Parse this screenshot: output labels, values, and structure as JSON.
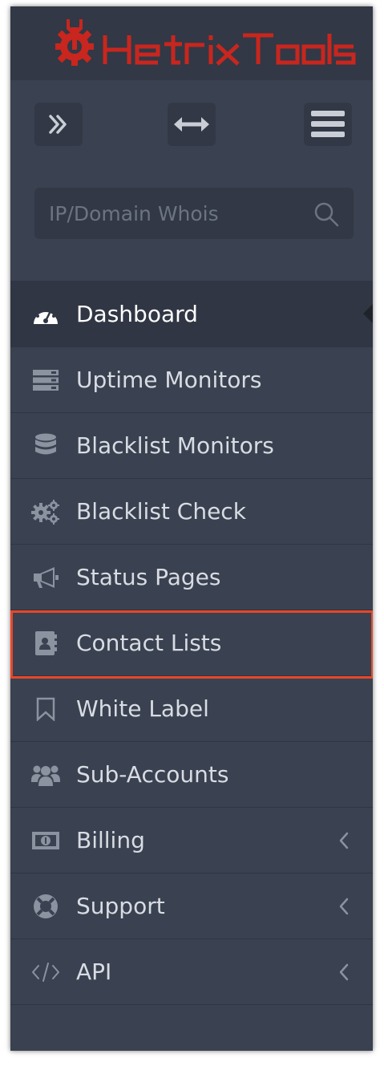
{
  "brand": {
    "name": "HetrixTools",
    "color": "#c8261e"
  },
  "toolbar": {
    "expand_icon": "double-chevron-right-icon",
    "resize_icon": "horizontal-arrows-icon",
    "menu_icon": "hamburger-icon"
  },
  "search": {
    "placeholder": "IP/Domain Whois",
    "value": "",
    "icon": "search-icon"
  },
  "menu": {
    "items": [
      {
        "label": "Dashboard",
        "icon": "gauge-icon",
        "active": true,
        "has_submenu": false
      },
      {
        "label": "Uptime Monitors",
        "icon": "server-icon",
        "active": false,
        "has_submenu": false
      },
      {
        "label": "Blacklist Monitors",
        "icon": "database-icon",
        "active": false,
        "has_submenu": false
      },
      {
        "label": "Blacklist Check",
        "icon": "gears-icon",
        "active": false,
        "has_submenu": false
      },
      {
        "label": "Status Pages",
        "icon": "megaphone-icon",
        "active": false,
        "has_submenu": false
      },
      {
        "label": "Contact Lists",
        "icon": "address-book-icon",
        "active": false,
        "highlighted": true,
        "has_submenu": false
      },
      {
        "label": "White Label",
        "icon": "bookmark-icon",
        "active": false,
        "has_submenu": false
      },
      {
        "label": "Sub-Accounts",
        "icon": "users-icon",
        "active": false,
        "has_submenu": false
      },
      {
        "label": "Billing",
        "icon": "money-bill-icon",
        "active": false,
        "has_submenu": true
      },
      {
        "label": "Support",
        "icon": "life-ring-icon",
        "active": false,
        "has_submenu": true
      },
      {
        "label": "API",
        "icon": "code-icon",
        "active": false,
        "has_submenu": true
      }
    ]
  },
  "colors": {
    "sidebar_bg": "#3a4150",
    "active_bg": "#303643",
    "highlight_border": "#e8472a",
    "icon": "#8b93a1"
  }
}
